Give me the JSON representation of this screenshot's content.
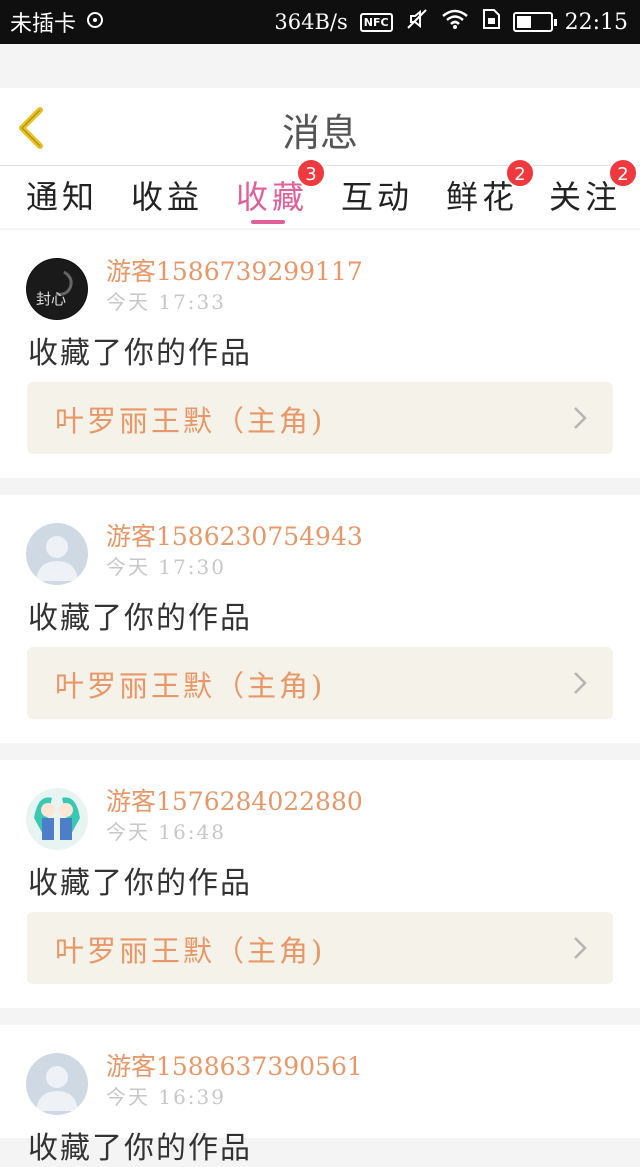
{
  "status_bar": {
    "carrier": "未插卡",
    "speed": "364B/s",
    "nfc": "NFC",
    "battery_level": 0.45,
    "time": "22:15"
  },
  "header": {
    "title": "消息"
  },
  "tabs": [
    {
      "label": "通知",
      "badge": ""
    },
    {
      "label": "收益",
      "badge": ""
    },
    {
      "label": "收藏",
      "badge": "3",
      "active": true
    },
    {
      "label": "互动",
      "badge": ""
    },
    {
      "label": "鲜花",
      "badge": "2"
    },
    {
      "label": "关注",
      "badge": "2"
    }
  ],
  "messages": [
    {
      "user": "游客1586739299117",
      "time": "今天 17:33",
      "action": "收藏了你的作品",
      "work": "叶罗丽王默（主角)",
      "avatar_text": "封心"
    },
    {
      "user": "游客1586230754943",
      "time": "今天 17:30",
      "action": "收藏了你的作品",
      "work": "叶罗丽王默（主角)"
    },
    {
      "user": "游客1576284022880",
      "time": "今天 16:48",
      "action": "收藏了你的作品",
      "work": "叶罗丽王默（主角)"
    },
    {
      "user": "游客1588637390561",
      "time": "今天 16:39",
      "action": "收藏了你的作品",
      "work": ""
    }
  ],
  "colors": {
    "accent": "#e0609a",
    "name": "#e89868",
    "badge": "#f0383f",
    "back_arrow": "#e8c020"
  }
}
